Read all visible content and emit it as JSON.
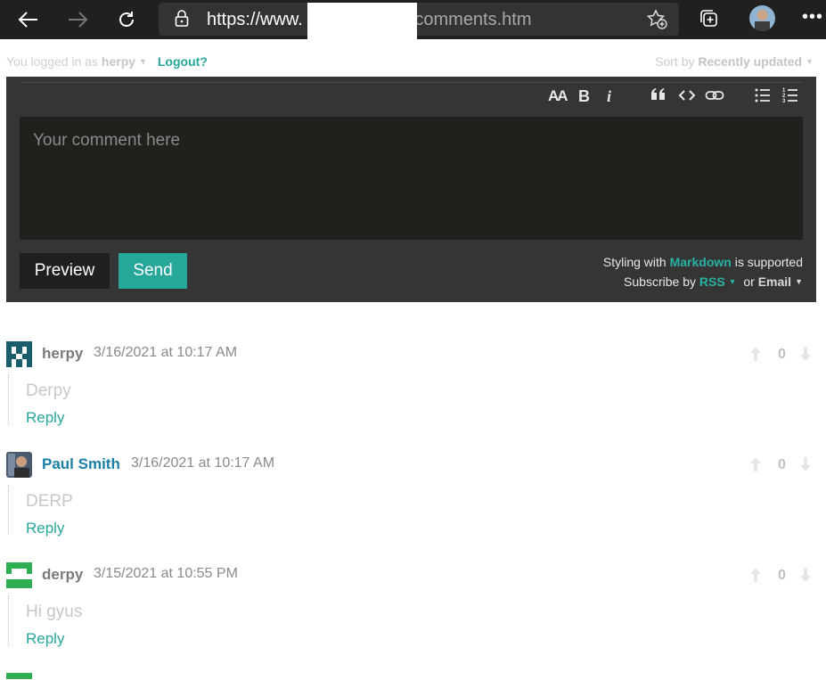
{
  "browser": {
    "url_prefix": "https://www.",
    "url_suffix": "/comments.htm"
  },
  "meta": {
    "logged_in_label": "You logged in as",
    "username": "herpy",
    "logout": "Logout?",
    "sort_label": "Sort by",
    "sort_value": "Recently updated"
  },
  "editor": {
    "toolbar": [
      "AA",
      "B",
      "i",
      "quote",
      "code",
      "link",
      "bulleted-list",
      "numbered-list"
    ],
    "placeholder": "Your comment here",
    "preview": "Preview",
    "send": "Send",
    "styling_prefix": "Styling with",
    "markdown": "Markdown",
    "styling_suffix": "is supported",
    "subscribe_by": "Subscribe by",
    "rss": "RSS",
    "or": "or",
    "email": "Email"
  },
  "comments": [
    {
      "author": "herpy",
      "time": "3/16/2021 at 10:17 AM",
      "text": "Derpy",
      "reply": "Reply",
      "votes": "0",
      "avatar_color": "#1a5e6e"
    },
    {
      "author": "Paul Smith",
      "time": "3/16/2021 at 10:17 AM",
      "text": "DERP",
      "reply": "Reply",
      "votes": "0",
      "avatar_color": "#6d5a4a"
    },
    {
      "author": "derpy",
      "time": "3/15/2021 at 10:55 PM",
      "text": "Hi gyus",
      "reply": "Reply",
      "votes": "0",
      "avatar_color": "#2fae52"
    }
  ],
  "colors": {
    "accent": "#27a69a",
    "link_blue": "#1a7fa6"
  }
}
